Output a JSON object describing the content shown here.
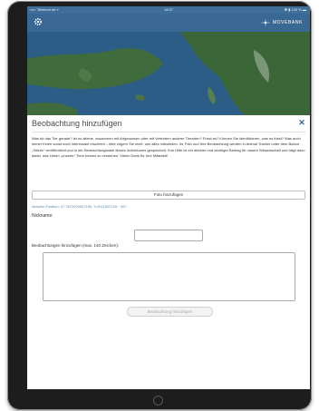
{
  "status_bar": {
    "carrier": "••••◦ Telekom.de ▿",
    "time": "18:37",
    "battery": "✱ ▮ 100 % ▬"
  },
  "navbar": {
    "settings_icon": "gear-icon",
    "brand_name": "MOVEBANK",
    "brand_logo": "movebank-logo-icon"
  },
  "colors": {
    "navbar": "#3a6895",
    "accent": "#3a6895",
    "map_sea": "#2b5d86",
    "map_land": "#3f6b3d"
  },
  "observation_form": {
    "title": "Beobachtung hinzufügen",
    "close_icon": "close-icon",
    "intro_text": "Was tut das Tier gerade? Ist es alleine, zusammen mit Artgenossen oder mit Vertretern anderer Tierarten? Frisst es? Können Sie identifizieren, was es frisst? Was auch immer Ihnen sonst noch interessant erscheint – bitte zögern Sie nicht, uns alles mitzuteilen. Ihr Foto und Ihre Beobachtung werden in Animal Tracker unter dem Button „Teilnfo“ veröffentlicht und in der Beobachtungsakte dieses Individuums gespeichert. Ihre Hilfe ist ein direkter und wichtiger Beitrag für unsere Wissenschaft und trägt dazu dabei, das Leben „unserer“ Tiere besser zu verstehen. Vielen Dank für Ihre Mitarbeit!",
    "add_photo_label": "Foto hinzufügen",
    "position_text": "Aktuelle Position: 47.7670009927190, 9.0041602709···557",
    "nickname_label": "Nickname:",
    "nickname_value": "",
    "observation_label": "Beobachtungen hinzufügen (max. 140 Zeichen):",
    "observation_value": "",
    "submit_label": "Beobachtung hinzufügen"
  }
}
